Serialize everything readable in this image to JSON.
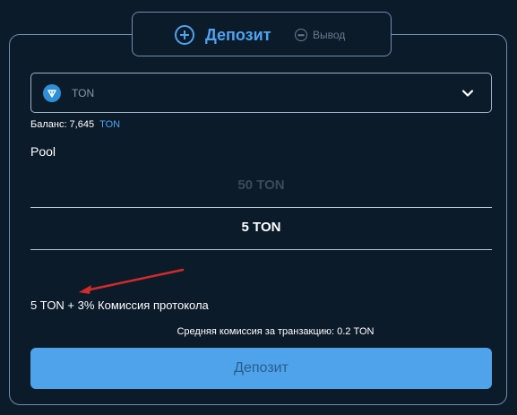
{
  "tabs": {
    "deposit_label": "Депозит",
    "withdraw_label": "Вывод"
  },
  "token_select": {
    "selected": "TON",
    "icon": "ton-logo-icon"
  },
  "balance": {
    "label": "Баланс: 7,645",
    "unit": "TON"
  },
  "pool": {
    "label": "Pool",
    "options": [
      "50 TON",
      "5 TON"
    ]
  },
  "fee_text": "5 TON + 3% Комиссия протокола",
  "avg_fee_text": "Средняя комиссия за транзакцию: 0.2 TON",
  "submit_label": "Депозит",
  "colors": {
    "background": "#0c1b2a",
    "accent": "#4ea3f1",
    "button": "#4ea3ea",
    "annotation_arrow": "#d42a2a"
  }
}
